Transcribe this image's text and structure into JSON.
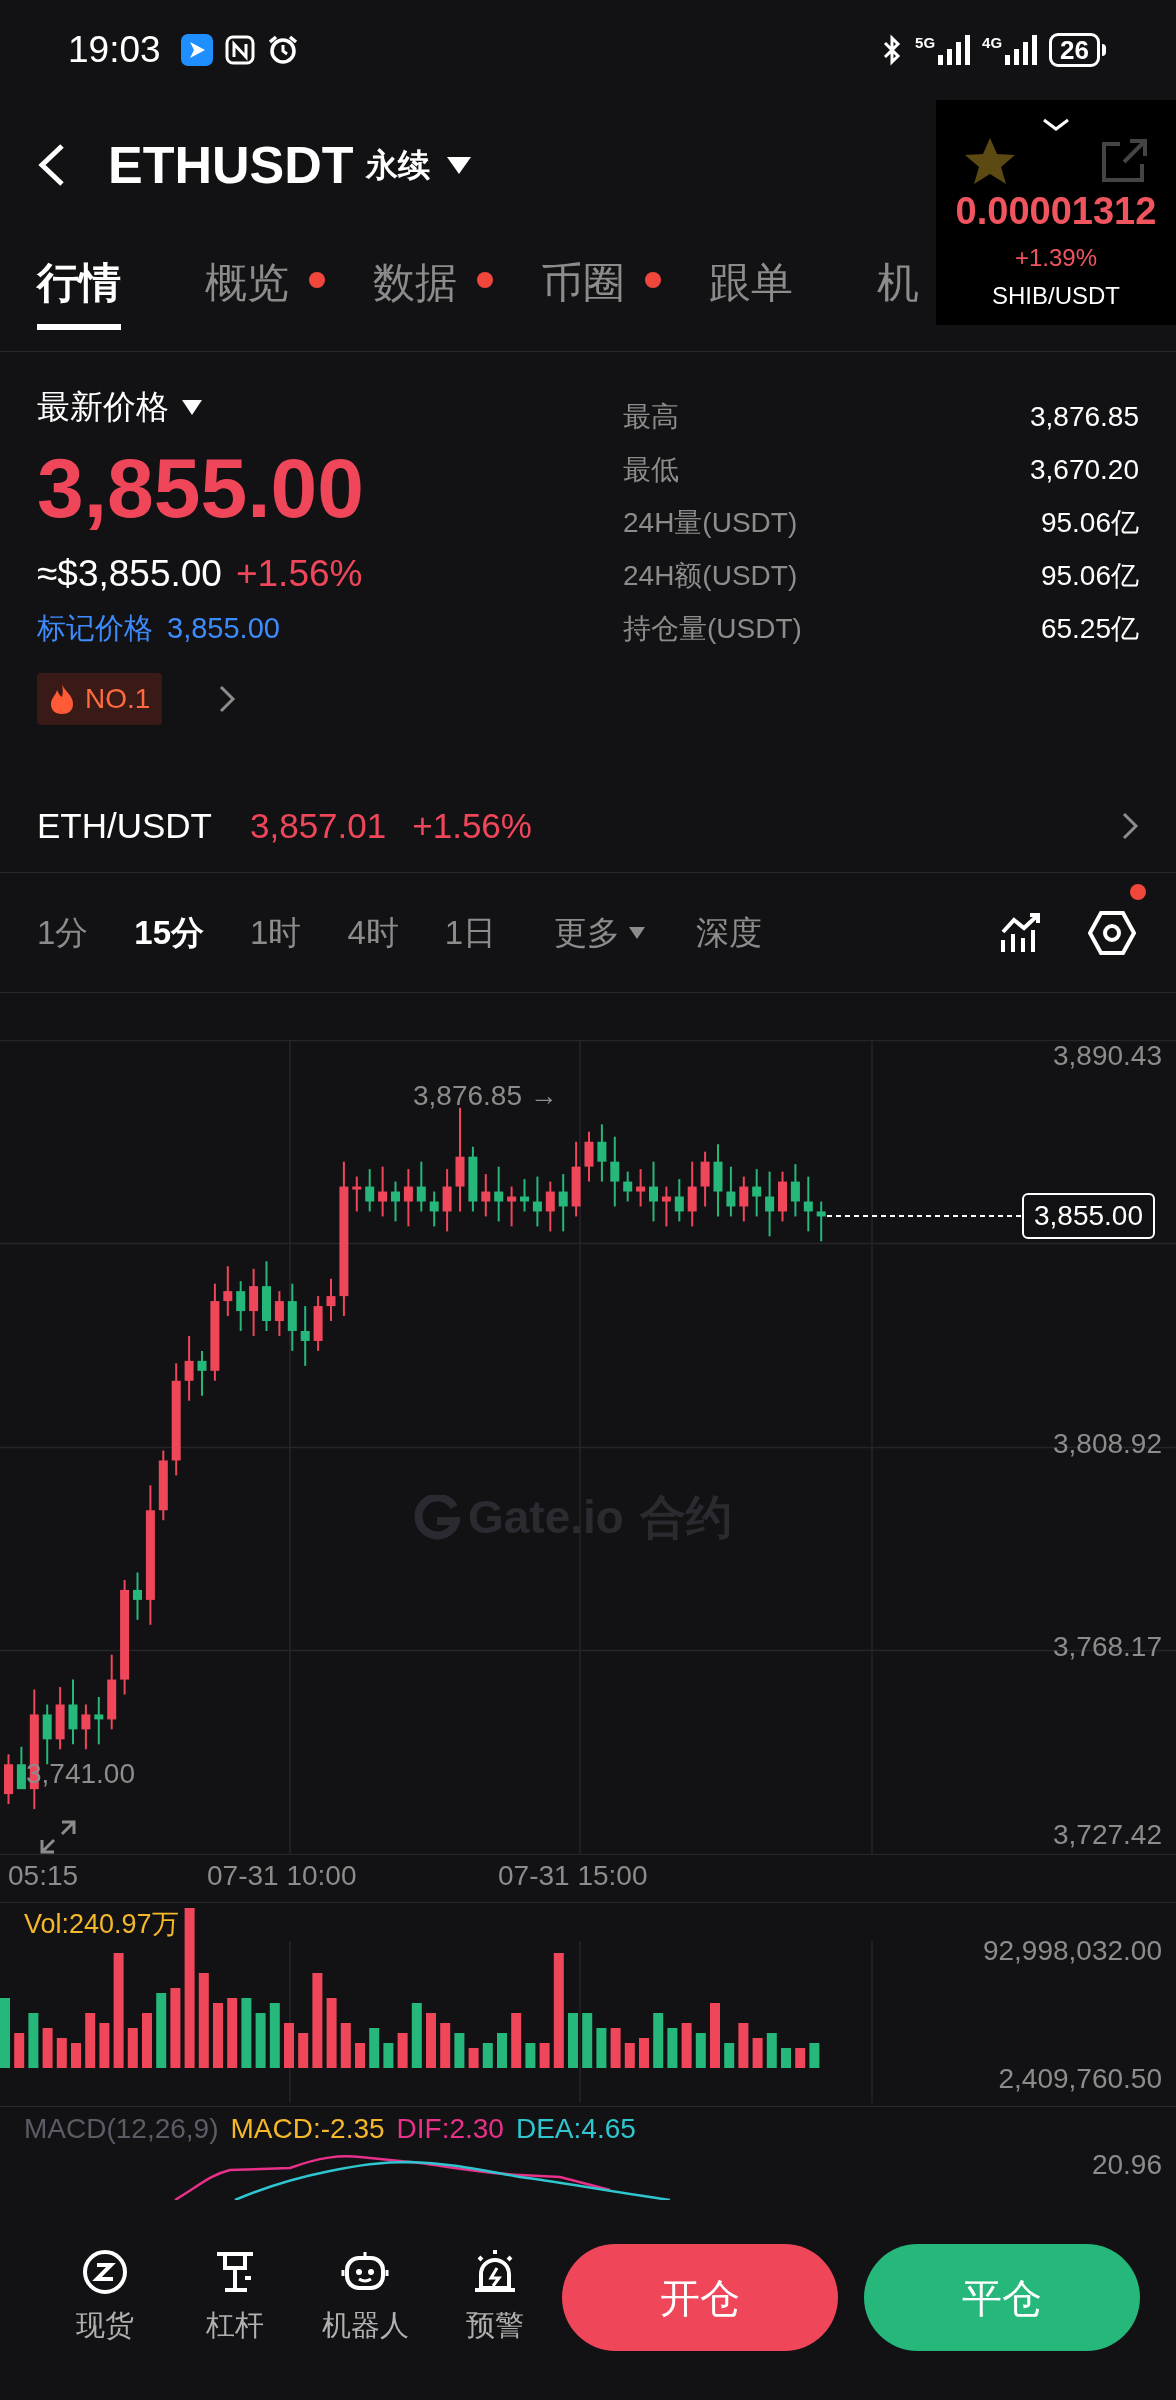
{
  "status_bar": {
    "time": "19:03",
    "networks": [
      "5G",
      "4G"
    ],
    "battery": "26"
  },
  "header": {
    "title": "ETHUSDT",
    "contract": "永续"
  },
  "floating_ticker": {
    "price": "0.00001312",
    "change": "+1.39%",
    "pair": "SHIB/USDT"
  },
  "tabs": [
    {
      "label": "行情",
      "selected": true,
      "dot": false
    },
    {
      "label": "概览",
      "selected": false,
      "dot": true
    },
    {
      "label": "数据",
      "selected": false,
      "dot": true
    },
    {
      "label": "币圈",
      "selected": false,
      "dot": true
    },
    {
      "label": "跟单",
      "selected": false,
      "dot": false
    },
    {
      "label": "机",
      "selected": false,
      "dot": false
    }
  ],
  "price": {
    "label": "最新价格",
    "last": "3,855.00",
    "usd": "≈$3,855.00",
    "change": "+1.56%",
    "mark_label": "标记价格",
    "mark": "3,855.00",
    "rank": "NO.1"
  },
  "stats": [
    {
      "label": "最高",
      "value": "3,876.85"
    },
    {
      "label": "最低",
      "value": "3,670.20"
    },
    {
      "label": "24H量(USDT)",
      "value": "95.06亿"
    },
    {
      "label": "24H额(USDT)",
      "value": "95.06亿"
    },
    {
      "label": "持仓量(USDT)",
      "value": "65.25亿"
    }
  ],
  "spot": {
    "pair": "ETH/USDT",
    "price": "3,857.01",
    "change": "+1.56%"
  },
  "intervals": [
    {
      "label": "1分",
      "selected": false
    },
    {
      "label": "15分",
      "selected": true
    },
    {
      "label": "1时",
      "selected": false
    },
    {
      "label": "4时",
      "selected": false
    },
    {
      "label": "1日",
      "selected": false
    }
  ],
  "more": "更多",
  "depth": "深度",
  "settings_dot": true,
  "chart": {
    "price_ticks": [
      "3,890.43",
      "3,808.92",
      "3,768.17",
      "3,727.42"
    ],
    "high_marker": "3,876.85 →",
    "low_marker": "3,741.00",
    "last_price": "3,855.00",
    "time_ticks": [
      "05:15",
      "07-31 10:00",
      "07-31 15:00"
    ],
    "watermark": "Gate.io",
    "watermark_suffix": "合约"
  },
  "volume": {
    "label": "Vol:240.97万",
    "ticks": [
      "92,998,032.00",
      "2,409,760.50"
    ]
  },
  "macd": {
    "label": "MACD(12,26,9)",
    "macd": "MACD:-2.35",
    "dif": "DIF:2.30",
    "dea": "DEA:4.65",
    "tick": "20.96"
  },
  "bottom_nav": [
    {
      "label": "现货",
      "kind": "spot"
    },
    {
      "label": "杠杆",
      "kind": "margin"
    },
    {
      "label": "机器人",
      "kind": "bot"
    },
    {
      "label": "预警",
      "kind": "alert"
    }
  ],
  "actions": [
    {
      "label": "开仓",
      "kind": "open"
    },
    {
      "label": "平仓",
      "kind": "close"
    }
  ]
}
